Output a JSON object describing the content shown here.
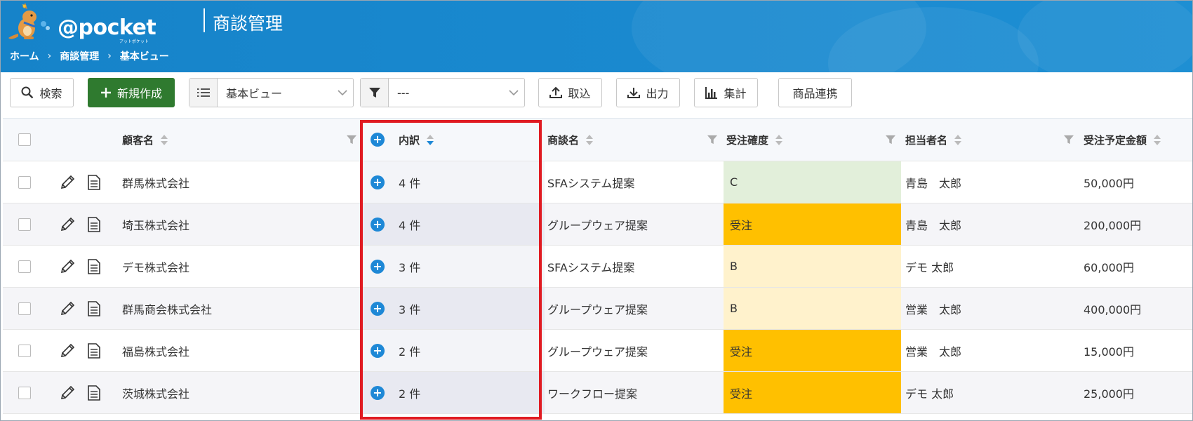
{
  "header": {
    "logo_text": "@pocket",
    "logo_sub": "アットポケット",
    "page_title": "商談管理",
    "breadcrumb": [
      "ホーム",
      "商談管理",
      "基本ビュー"
    ],
    "breadcrumb_sep": "›"
  },
  "toolbar": {
    "search_label": "検索",
    "new_label": "新規作成",
    "view_select_value": "基本ビュー",
    "filter_select_value": "---",
    "import_label": "取込",
    "export_label": "出力",
    "aggregate_label": "集計",
    "product_link_label": "商品連携"
  },
  "table": {
    "headers": {
      "customer": "顧客名",
      "breakdown": "内訳",
      "deal": "商談名",
      "confidence": "受注確度",
      "owner": "担当者名",
      "amount": "受注予定金額"
    },
    "rows": [
      {
        "customer": "群馬株式会社",
        "breakdown": "4 件",
        "deal": "SFAシステム提案",
        "confidence": "C",
        "owner": "青島　太郎",
        "amount": "50,000円"
      },
      {
        "customer": "埼玉株式会社",
        "breakdown": "4 件",
        "deal": "グループウェア提案",
        "confidence": "受注",
        "owner": "青島　太郎",
        "amount": "200,000円"
      },
      {
        "customer": "デモ株式会社",
        "breakdown": "3 件",
        "deal": "SFAシステム提案",
        "confidence": "B",
        "owner": "デモ 太郎",
        "amount": "60,000円"
      },
      {
        "customer": "群馬商会株式会社",
        "breakdown": "3 件",
        "deal": "グループウェア提案",
        "confidence": "B",
        "owner": "営業　太郎",
        "amount": "400,000円"
      },
      {
        "customer": "福島株式会社",
        "breakdown": "2 件",
        "deal": "グループウェア提案",
        "confidence": "受注",
        "owner": "営業　太郎",
        "amount": "15,000円"
      },
      {
        "customer": "茨城株式会社",
        "breakdown": "2 件",
        "deal": "ワークフロー提案",
        "confidence": "受注",
        "owner": "デモ 太郎",
        "amount": "25,000円"
      }
    ]
  },
  "colors": {
    "header_bg": "#1683c9",
    "new_button": "#2f7a2f",
    "accent_blue": "#1e88d6",
    "highlight_border": "#e01b22",
    "confidence_C": "#e2efda",
    "confidence_B": "#fff2cc",
    "confidence_won": "#ffc000"
  }
}
